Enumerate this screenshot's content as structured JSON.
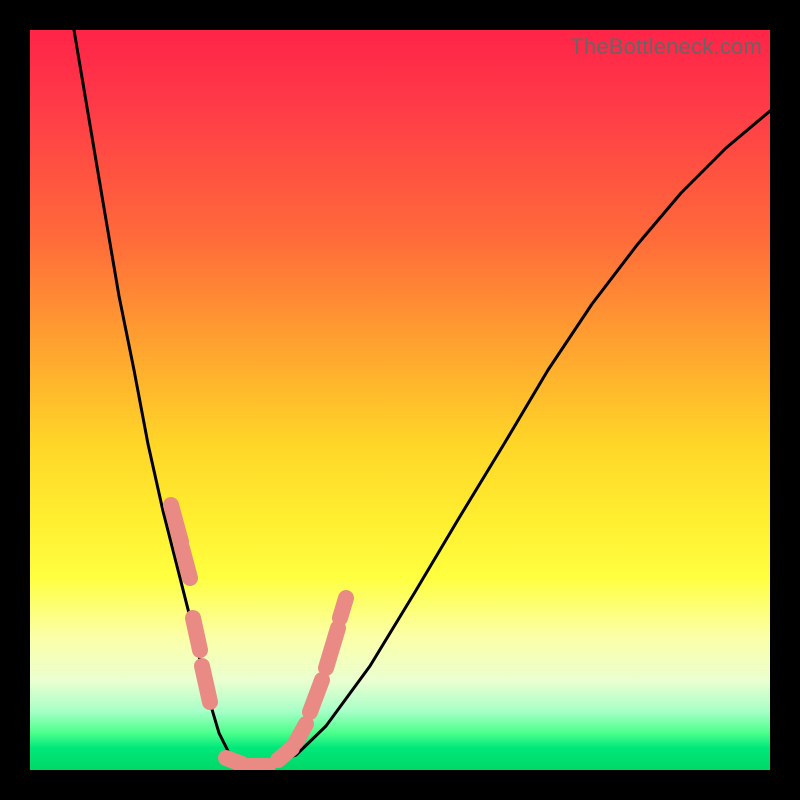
{
  "watermark": "TheBottleneck.com",
  "chart_data": {
    "type": "line",
    "title": "",
    "xlabel": "",
    "ylabel": "",
    "xlim": [
      0,
      100
    ],
    "ylim": [
      0,
      100
    ],
    "series": [
      {
        "name": "curve",
        "x": [
          6,
          8,
          10,
          12,
          14,
          16,
          18,
          20,
          22,
          24,
          25.5,
          27,
          29,
          32,
          36,
          40,
          46,
          52,
          58,
          64,
          70,
          76,
          82,
          88,
          94,
          100
        ],
        "y": [
          100,
          88,
          76,
          64,
          54,
          44,
          35,
          27,
          19,
          10,
          5,
          2,
          0.5,
          0.5,
          2,
          6,
          14,
          24,
          34,
          44,
          54,
          63,
          71,
          78,
          84,
          89
        ]
      }
    ],
    "markers": [
      {
        "name": "left-cluster-upper",
        "x_range": [
          19,
          21.5
        ],
        "y_range": [
          24,
          36
        ]
      },
      {
        "name": "left-cluster-lower",
        "x_range": [
          22,
          24.5
        ],
        "y_range": [
          8,
          20
        ]
      },
      {
        "name": "bottom-cluster",
        "x_range": [
          26,
          32
        ],
        "y_range": [
          0,
          2
        ]
      },
      {
        "name": "right-cluster-lower",
        "x_range": [
          33,
          37
        ],
        "y_range": [
          2,
          8
        ]
      },
      {
        "name": "right-cluster-upper",
        "x_range": [
          37,
          42
        ],
        "y_range": [
          10,
          24
        ]
      }
    ],
    "colors": {
      "curve": "#000000",
      "markers": "#e98b84",
      "background_top": "#ff2448",
      "background_mid": "#ffee30",
      "background_bottom": "#00d868"
    }
  }
}
